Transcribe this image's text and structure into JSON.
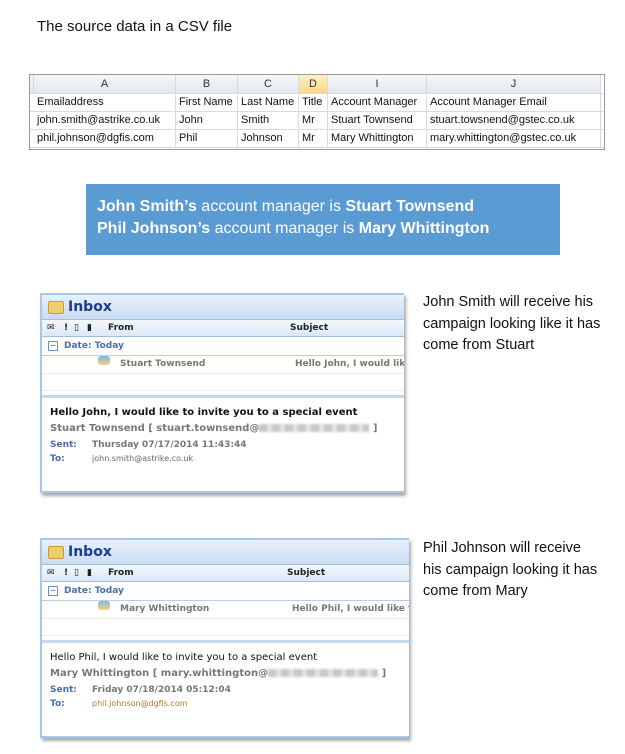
{
  "title": "The source data in a CSV file",
  "sheet": {
    "col_letters": [
      "A",
      "B",
      "C",
      "D",
      "I",
      "J"
    ],
    "headers": [
      "Emailaddress",
      "First Name",
      "Last Name",
      "Title",
      "Account Manager",
      "Account Manager Email"
    ],
    "rows": [
      [
        "john.smith@astrike.co.uk",
        "John",
        "Smith",
        "Mr",
        "Stuart Townsend",
        "stuart.towsnend@gstec.co.uk"
      ],
      [
        "phil.johnson@dgfis.com",
        "Phil",
        "Johnson",
        "Mr",
        "Mary Whittington",
        "mary.whittington@gstec.co.uk"
      ]
    ]
  },
  "banner": {
    "line1": {
      "name": "John Smith’s",
      "mid": " account manager is ",
      "manager": "Stuart Townsend"
    },
    "line2": {
      "name": "Phil Johnson’s",
      "mid": " account manager is ",
      "manager": "Mary Whittington"
    },
    "color": "#5a9bd3"
  },
  "emails": [
    {
      "folder": "Inbox",
      "col_from": "From",
      "col_subject": "Subject",
      "group": "Date: Today",
      "sender": "Stuart Townsend",
      "subject_preview": "Hello John, I would lik",
      "subject": "Hello John, I would like to invite you to a special event",
      "from_line": "Stuart Townsend [ stuart.townsend@",
      "from_end": " ]",
      "sent_label": "Sent:",
      "sent": "Thursday 07/17/2014 11:43:44",
      "to_label": "To:",
      "to": "john.smith@astrike.co.uk",
      "note": "John Smith will receive his campaign looking like it has come from Stuart"
    },
    {
      "folder": "Inbox",
      "col_from": "From",
      "col_subject": "Subject",
      "group": "Date: Today",
      "sender": "Mary Whittington",
      "subject_preview": "Hello Phil, I would like to",
      "subject": "Hello Phil, I would like to invite you to a special event",
      "from_line": "Mary Whittington [ mary.whittington@",
      "from_end": " ]",
      "sent_label": "Sent:",
      "sent": "Friday 07/18/2014 05:12:04",
      "to_label": "To:",
      "to": "phil.johnson@dgfis.com",
      "note": "Phil Johnson will receive his campaign looking it has come from Mary"
    }
  ]
}
